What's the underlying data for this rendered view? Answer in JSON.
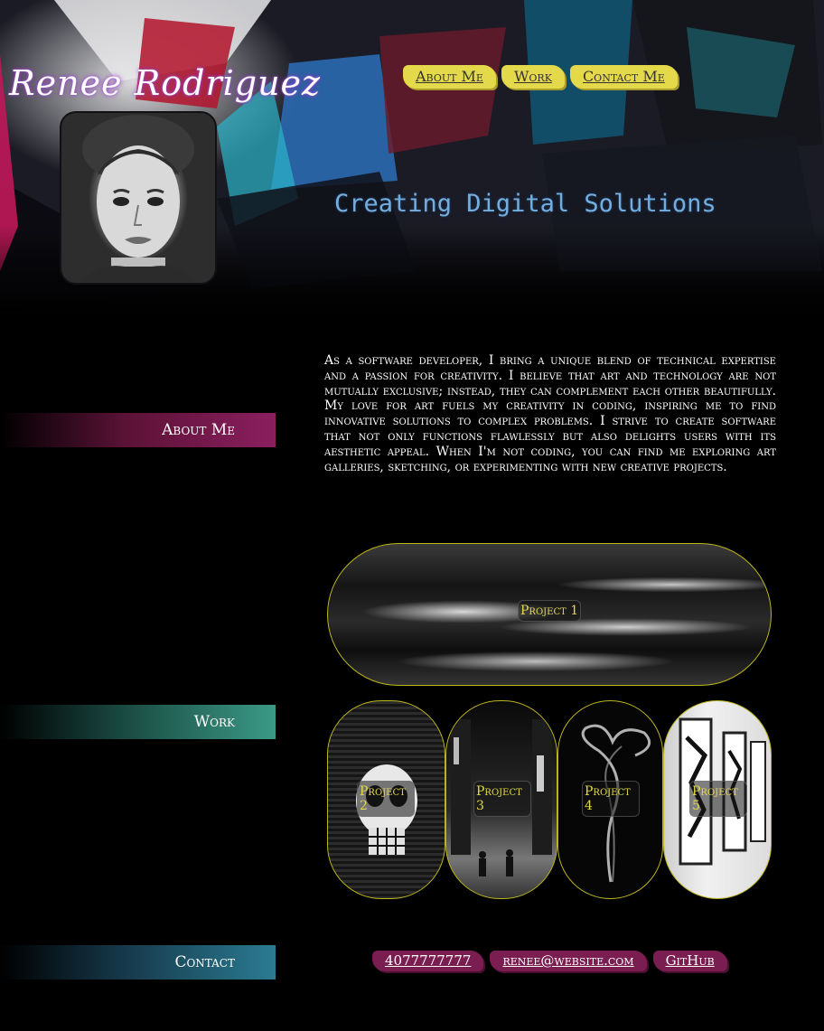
{
  "header": {
    "brand_name": "Renee Rodriguez",
    "tagline": "Creating Digital Solutions",
    "nav": [
      "About Me",
      "Work",
      "Contact Me"
    ]
  },
  "sections": {
    "about_label": "About Me",
    "work_label": "Work",
    "contact_label": "Contact"
  },
  "about": {
    "text": "As a software developer, I bring a unique blend of technical expertise and a passion for creativity. I believe that art and technology are not mutually exclusive; instead, they can complement each other beautifully. My love for art fuels my creativity in coding, inspiring me to find innovative solutions to complex problems. I strive to create software that not only functions flawlessly but also delights users with its aesthetic appeal. When I'm not coding, you can find me exploring art galleries, sketching, or experimenting with new creative projects."
  },
  "projects": [
    "Project 1",
    "Project 2",
    "Project 3",
    "Project 4",
    "Project 5"
  ],
  "contact": {
    "phone": "4077777777",
    "email": "renee@website.com",
    "github": "GitHub"
  },
  "colors": {
    "nav_bg": "#e4d94a",
    "tagline": "#74aede",
    "contact_bg": "#7a1e52",
    "about_band": "#8b1f5f",
    "work_band": "#3b9a86",
    "contact_band": "#2b7b92",
    "project_border": "#bcb41a"
  }
}
